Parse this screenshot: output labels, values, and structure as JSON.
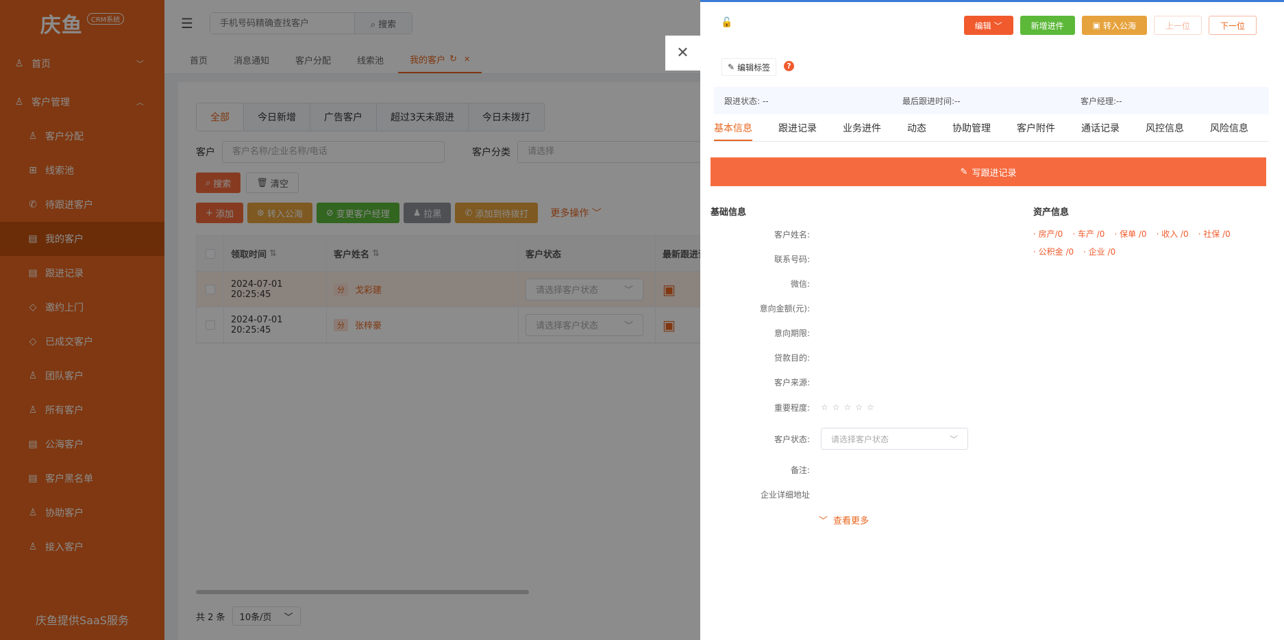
{
  "sidebar": {
    "logo_text": "庆鱼",
    "logo_badge": "CRM系统",
    "items": [
      {
        "label": "首页",
        "icon": "person-icon",
        "chevron": "﹀"
      },
      {
        "label": "客户管理",
        "icon": "users-icon",
        "chevron": "︿"
      },
      {
        "label": "客户分配",
        "icon": "person-icon"
      },
      {
        "label": "线索池",
        "icon": "grid-icon"
      },
      {
        "label": "待跟进客户",
        "icon": "phone-icon"
      },
      {
        "label": "我的客户",
        "icon": "doc-icon"
      },
      {
        "label": "跟进记录",
        "icon": "doc-icon"
      },
      {
        "label": "邀约上门",
        "icon": "diamond-icon"
      },
      {
        "label": "已成交客户",
        "icon": "diamond-icon"
      },
      {
        "label": "团队客户",
        "icon": "person-icon"
      },
      {
        "label": "所有客户",
        "icon": "person-icon"
      },
      {
        "label": "公海客户",
        "icon": "doc-icon"
      },
      {
        "label": "客户黑名单",
        "icon": "doc-icon"
      },
      {
        "label": "协助客户",
        "icon": "person-icon"
      },
      {
        "label": "接入客户",
        "icon": "person-icon"
      }
    ],
    "footer": "庆鱼提供SaaS服务",
    "color": "#e8661f"
  },
  "topbar": {
    "search_placeholder": "手机号码精确查找客户",
    "search_button": "搜索"
  },
  "tabs": [
    {
      "label": "首页"
    },
    {
      "label": "消息通知"
    },
    {
      "label": "客户分配"
    },
    {
      "label": "线索池"
    },
    {
      "label": "我的客户"
    }
  ],
  "filter_tabs": [
    "全部",
    "今日新增",
    "广告客户",
    "超过3天未跟进",
    "今日未拨打"
  ],
  "filters": {
    "customer_label": "客户",
    "customer_placeholder": "客户名称/企业名称/电话",
    "category_label": "客户分类",
    "category_placeholder": "请选择",
    "search_btn": "搜索",
    "clear_btn": "清空"
  },
  "actions": {
    "add": "添加",
    "to_pool": "转入公海",
    "change_manager": "变更客户经理",
    "blacklist": "拉黑",
    "add_to_dial": "添加到待拨打",
    "more": "更多操作"
  },
  "table": {
    "headers": [
      "领取时间",
      "客户姓名",
      "客户状态",
      "最新跟进记录"
    ],
    "rows": [
      {
        "time": "2024-07-01 20:25:45",
        "tag": "分",
        "name": "戈彩建",
        "status_placeholder": "请选择客户状态"
      },
      {
        "time": "2024-07-01 20:25:45",
        "tag": "分",
        "name": "张梓豪",
        "status_placeholder": "请选择客户状态"
      }
    ]
  },
  "pager": {
    "total": "共 2 条",
    "page_size": "10条/页"
  },
  "drawer": {
    "buttons": {
      "edit": "编辑",
      "new_progress": "新增进件",
      "to_pool": "转入公海",
      "prev": "上一位",
      "next": "下一位"
    },
    "edit_tag": "编辑标签",
    "info": {
      "follow_status": "跟进状态: --",
      "last_follow_time": "最后跟进时间:--",
      "manager": "客户经理:--"
    },
    "tabs": [
      "基本信息",
      "跟进记录",
      "业务进件",
      "动态",
      "协助管理",
      "客户附件",
      "通话记录",
      "风控信息",
      "风险信息"
    ],
    "write_button": "写跟进记录",
    "basic_title": "基础信息",
    "asset_title": "资产信息",
    "fields": {
      "name": "客户姓名:",
      "phone": "联系号码:",
      "wechat": "微信:",
      "amount": "意向金额(元):",
      "term": "意向期限:",
      "purpose": "贷款目的:",
      "source": "客户来源:",
      "importance": "重要程度:",
      "status": "客户状态:",
      "remark": "备注:",
      "address": "企业详细地址"
    },
    "importance_rating": 0,
    "status_placeholder": "请选择客户状态",
    "view_more": "查看更多",
    "assets": [
      "· 房产/0",
      "· 车产 /0",
      "· 保单 /0",
      "· 收入 /0",
      "· 社保 /0",
      "· 公积金 /0",
      "· 企业 /0"
    ]
  }
}
